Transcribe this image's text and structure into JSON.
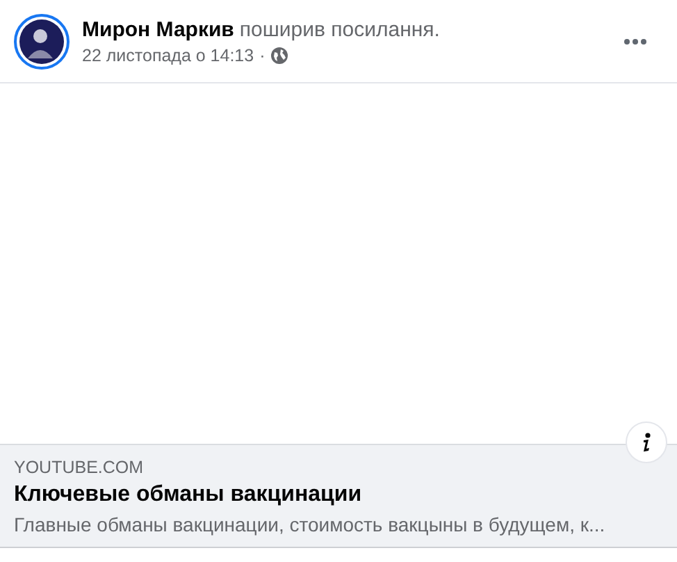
{
  "post": {
    "author": "Мирон Маркив",
    "action": "поширив посилання.",
    "time": "22 листопада о 14:13",
    "separator": "·"
  },
  "link_preview": {
    "domain": "YOUTUBE.COM",
    "title": "Ключевые обманы вакцинации",
    "description": "Главные обманы вакцинации, стоимость вакцыны в будущем, к..."
  }
}
